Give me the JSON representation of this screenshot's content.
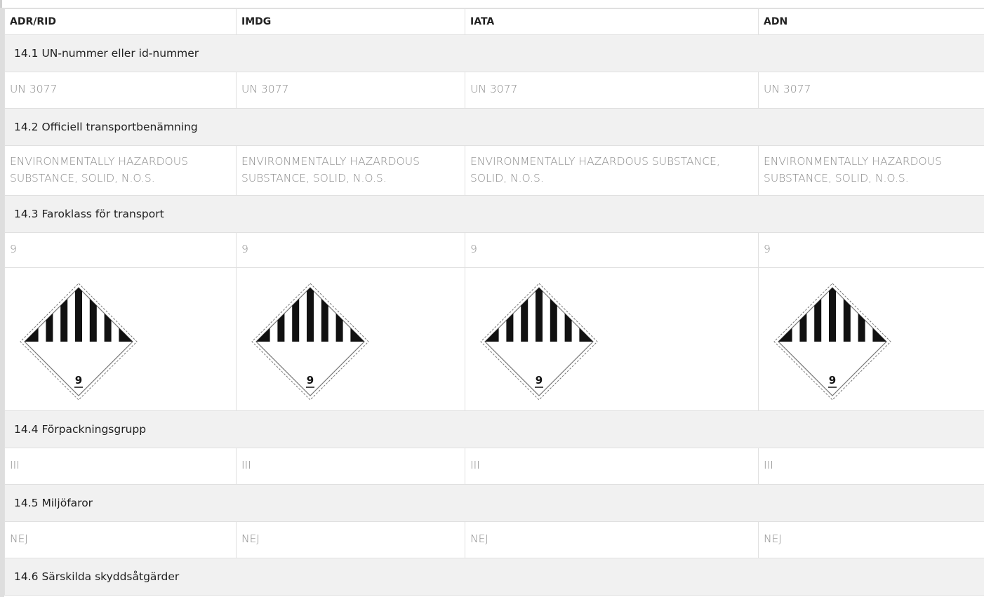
{
  "headers": [
    "ADR/RID",
    "IMDG",
    "IATA",
    "ADN"
  ],
  "sections": [
    {
      "title": "14.1 UN-nummer eller id-nummer",
      "values": [
        "UN 3077",
        "UN 3077",
        "UN 3077",
        "UN 3077"
      ]
    },
    {
      "title": "14.2 Officiell transportbenämning",
      "values": [
        "ENVIRONMENTALLY HAZARDOUS SUBSTANCE, SOLID, N.O.S.",
        "ENVIRONMENTALLY HAZARDOUS SUBSTANCE, SOLID, N.O.S.",
        "ENVIRONMENTALLY HAZARDOUS SUBSTANCE, SOLID, N.O.S.",
        "ENVIRONMENTALLY HAZARDOUS SUBSTANCE, SOLID, N.O.S."
      ]
    },
    {
      "title": "14.3 Faroklass för transport",
      "values": [
        "9",
        "9",
        "9",
        "9"
      ],
      "pictograms": [
        "class-9-hazard-label-icon",
        "class-9-hazard-label-icon",
        "class-9-hazard-label-icon",
        "class-9-hazard-label-icon"
      ],
      "pictogram_text": "9"
    },
    {
      "title": "14.4 Förpackningsgrupp",
      "values": [
        "III",
        "III",
        "III",
        "III"
      ]
    },
    {
      "title": "14.5 Miljöfaror",
      "values": [
        "NEJ",
        "NEJ",
        "NEJ",
        "NEJ"
      ]
    },
    {
      "title": "14.6 Särskilda skyddsåtgärder"
    }
  ]
}
